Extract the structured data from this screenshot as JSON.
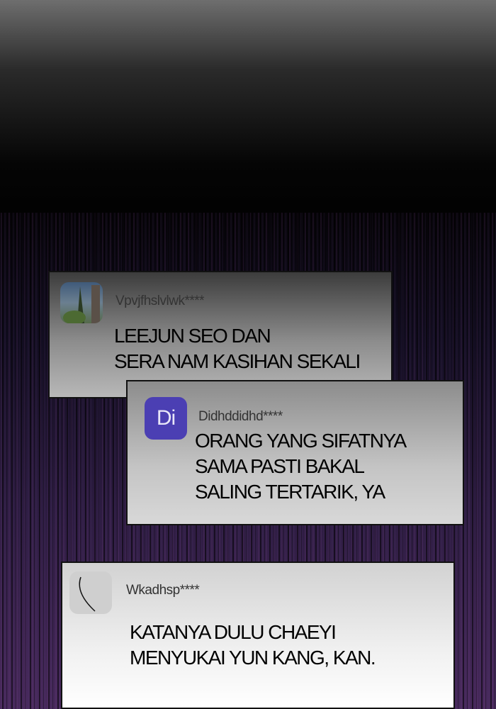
{
  "comments": [
    {
      "username": "Vpvjfhslvlwk****",
      "lines": [
        "LEEJUN SEO DAN",
        "SERA NAM KASIHAN SEKALI"
      ],
      "avatar": "photo-avatar"
    },
    {
      "username": "Didhddidhd****",
      "avatar_text": "Di",
      "avatar_color": "#4b3fb3",
      "lines": [
        "ORANG YANG SIFATNYA",
        "SAMA PASTI BAKAL",
        "SALING TERTARIK, YA"
      ]
    },
    {
      "username": "Wkadhsp****",
      "lines": [
        "KATANYA DULU CHAEYI",
        "MENYUKAI YUN KANG, KAN."
      ],
      "avatar": "sketch-avatar"
    }
  ]
}
